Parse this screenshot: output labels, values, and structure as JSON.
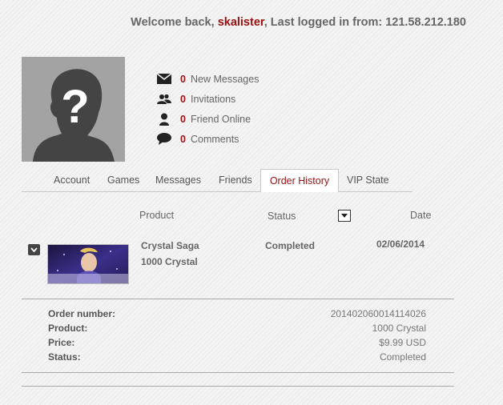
{
  "welcome": {
    "prefix": "Welcome back,",
    "username": "skalister",
    "suffix": ", Last logged in from: 121.58.212.180"
  },
  "stats": [
    {
      "icon": "envelope-icon",
      "count": "0",
      "label": "New Messages"
    },
    {
      "icon": "users-icon",
      "count": "0",
      "label": "Invitations"
    },
    {
      "icon": "person-icon",
      "count": "0",
      "label": "Friend Online"
    },
    {
      "icon": "speech-bubble-icon",
      "count": "0",
      "label": "Comments"
    }
  ],
  "tabs": [
    "Account",
    "Games",
    "Messages",
    "Friends",
    "Order History",
    "VIP State"
  ],
  "active_tab": "Order History",
  "table": {
    "headers": {
      "product": "Product",
      "status": "Status",
      "date": "Date"
    },
    "order": {
      "game": "Crystal Saga",
      "item": "1000 Crystal",
      "status": "Completed",
      "date": "02/06/2014"
    }
  },
  "details": [
    {
      "label": "Order number:",
      "value": "20140206001411402​6"
    },
    {
      "label": "Product:",
      "value": "1000 Crystal"
    },
    {
      "label": "Price:",
      "value": "$9.99 USD"
    },
    {
      "label": "Status:",
      "value": "Completed"
    }
  ],
  "colors": {
    "accent": "#9a1010",
    "avatar_bg": "#a3a3a3"
  }
}
